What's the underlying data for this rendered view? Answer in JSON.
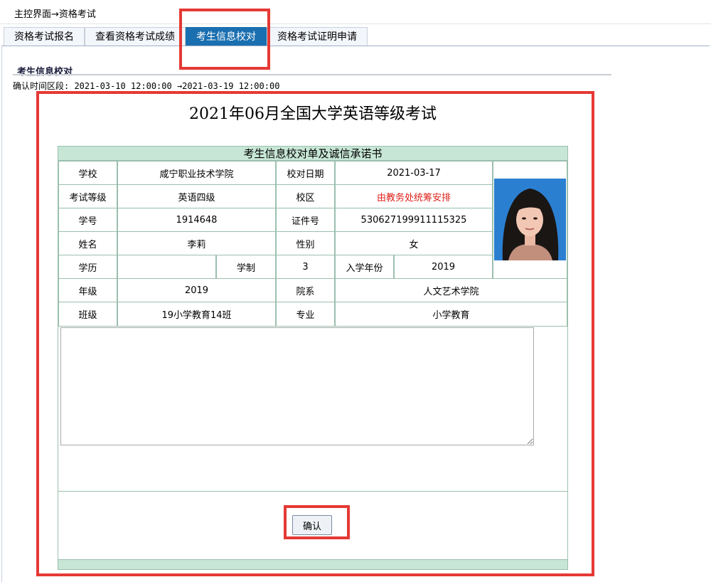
{
  "breadcrumb": "主控界面→资格考试",
  "tabs": [
    {
      "label": "资格考试报名"
    },
    {
      "label": "查看资格考试成绩"
    },
    {
      "label": "考生信息校对"
    },
    {
      "label": "资格考试证明申请"
    }
  ],
  "section_title": "考生信息校对",
  "time_range_label": "确认时间区段: 2021-03-10 12:00:00 →2021-03-19 12:00:00",
  "exam_title": "2021年06月全国大学英语等级考试",
  "form": {
    "header": "考生信息校对单及诚信承诺书",
    "labels": {
      "school": "学校",
      "check_date": "校对日期",
      "exam_level": "考试等级",
      "campus": "校区",
      "student_no": "学号",
      "id_no": "证件号",
      "name": "姓名",
      "gender": "性别",
      "education": "学历",
      "schooling": "学制",
      "enroll_year": "入学年份",
      "grade": "年级",
      "department": "院系",
      "class": "班级",
      "major": "专业"
    },
    "values": {
      "school": "咸宁职业技术学院",
      "check_date": "2021-03-17",
      "exam_level": "英语四级",
      "campus": "由教务处统筹安排",
      "student_no": "1914648",
      "id_no": "530627199911115325",
      "name": "李莉",
      "gender": "女",
      "education": "",
      "schooling": "3",
      "enroll_year": "2019",
      "grade": "2019",
      "department": "人文艺术学院",
      "class": "19小学教育14班",
      "major": "小学教育"
    },
    "remark_value": "",
    "confirm_label": "确认"
  },
  "colors": {
    "tab_active_bg": "#1a6fb0",
    "form_header_bg": "#c7e6d6",
    "campus_text": "#e0201a",
    "highlight_box": "#e53935",
    "photo_bg": "#2b7fd1"
  }
}
